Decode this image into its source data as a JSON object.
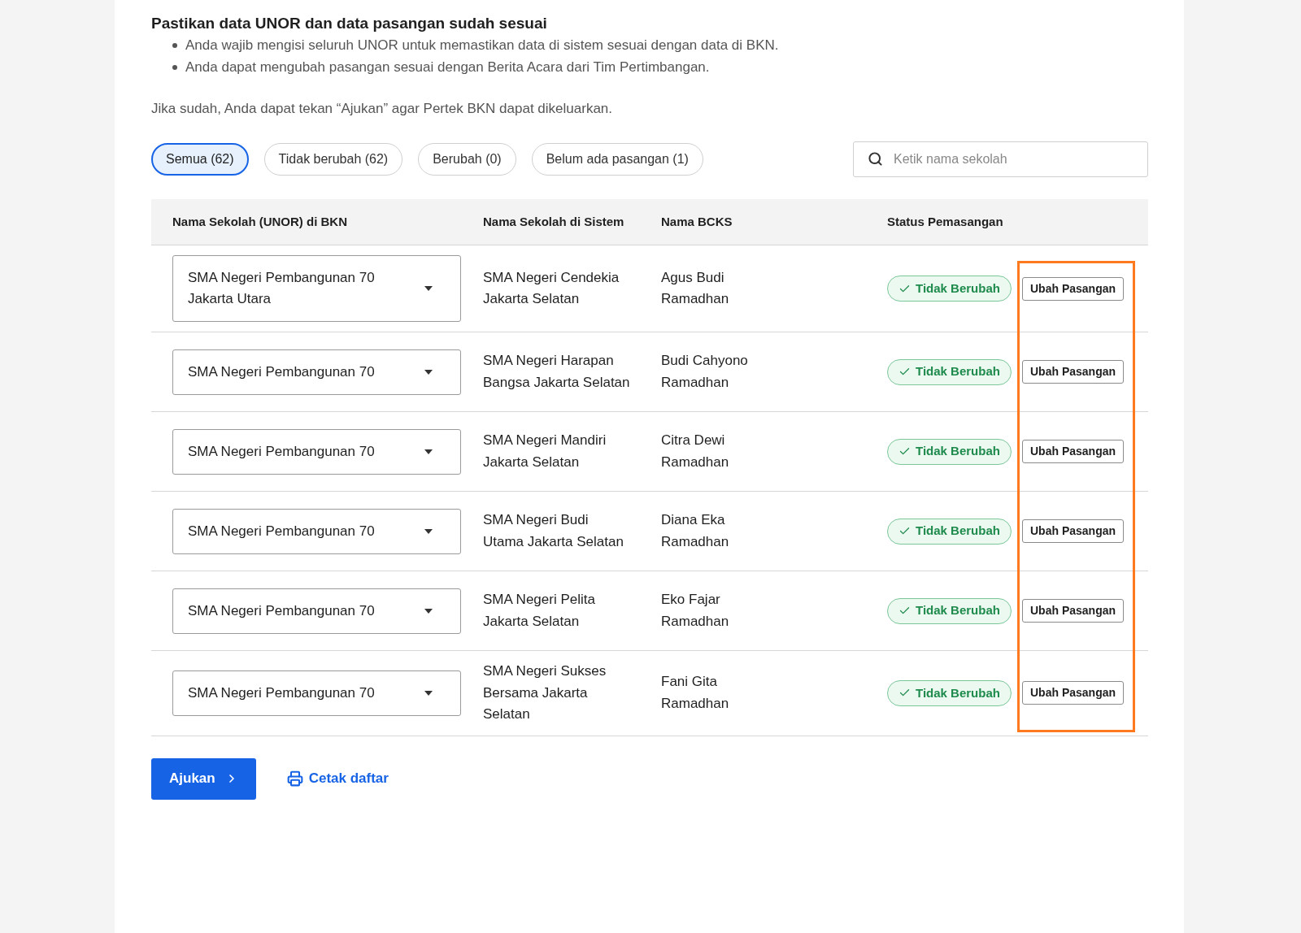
{
  "heading": "Pastikan data UNOR dan data pasangan sudah sesuai",
  "bullets": [
    "Anda wajib mengisi seluruh UNOR untuk memastikan data di sistem sesuai dengan data di BKN.",
    "Anda dapat mengubah pasangan sesuai dengan Berita Acara dari Tim Pertimbangan."
  ],
  "note": "Jika sudah, Anda dapat tekan “Ajukan” agar Pertek BKN dapat dikeluarkan.",
  "filters": [
    {
      "label": "Semua (62)",
      "selected": true
    },
    {
      "label": "Tidak berubah (62)",
      "selected": false
    },
    {
      "label": "Berubah (0)",
      "selected": false
    },
    {
      "label": "Belum ada pasangan (1)",
      "selected": false
    }
  ],
  "search": {
    "placeholder": "Ketik nama sekolah"
  },
  "table": {
    "columns": [
      "Nama Sekolah (UNOR) di BKN",
      "Nama Sekolah di Sistem",
      "Nama BCKS",
      "Status Pemasangan"
    ],
    "rows": [
      {
        "unor": "SMA Negeri Pembangunan 70 Jakarta Utara",
        "system": "SMA Negeri Cendekia Jakarta Selatan",
        "bcks": "Agus Budi Ramadhan",
        "status": "Tidak Berubah",
        "action": "Ubah Pasangan"
      },
      {
        "unor": "SMA Negeri Pembangunan 70",
        "system": "SMA Negeri Harapan Bangsa Jakarta Selatan",
        "bcks": "Budi Cahyono Ramadhan",
        "status": "Tidak Berubah",
        "action": "Ubah Pasangan"
      },
      {
        "unor": "SMA Negeri Pembangunan 70",
        "system": "SMA Negeri Mandiri Jakarta Selatan",
        "bcks": "Citra Dewi Ramadhan",
        "status": "Tidak Berubah",
        "action": "Ubah Pasangan"
      },
      {
        "unor": "SMA Negeri Pembangunan 70",
        "system": "SMA Negeri Budi Utama Jakarta Selatan",
        "bcks": "Diana Eka Ramadhan",
        "status": "Tidak Berubah",
        "action": "Ubah Pasangan"
      },
      {
        "unor": "SMA Negeri Pembangunan 70",
        "system": "SMA Negeri Pelita Jakarta Selatan",
        "bcks": "Eko Fajar Ramadhan",
        "status": "Tidak Berubah",
        "action": "Ubah Pasangan"
      },
      {
        "unor": "SMA Negeri Pembangunan 70",
        "system": "SMA Negeri Sukses Bersama Jakarta Selatan",
        "bcks": "Fani Gita Ramadhan",
        "status": "Tidak Berubah",
        "action": "Ubah Pasangan"
      }
    ]
  },
  "actions": {
    "submit": "Ajukan",
    "print": "Cetak daftar"
  }
}
